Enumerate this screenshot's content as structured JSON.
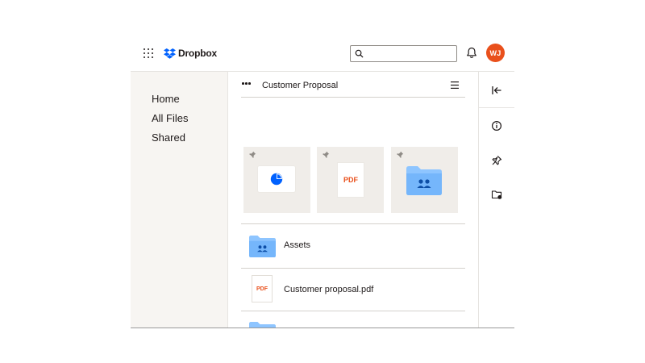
{
  "header": {
    "brand": "Dropbox",
    "search": {
      "value": "",
      "placeholder": ""
    },
    "avatar_initials": "WJ",
    "brand_color": "#0061fe",
    "avatar_color": "#e9501c"
  },
  "sidebar": {
    "items": [
      {
        "label": "Home"
      },
      {
        "label": "All Files"
      },
      {
        "label": "Shared"
      }
    ]
  },
  "main": {
    "breadcrumb_title": "Customer Proposal",
    "pinned": [
      {
        "kind": "presentation",
        "icon": "pie-chart-icon"
      },
      {
        "kind": "pdf",
        "label": "PDF"
      },
      {
        "kind": "shared-folder",
        "icon": "shared-folder-icon"
      }
    ],
    "files": [
      {
        "name": "Assets",
        "type": "shared-folder"
      },
      {
        "name": "Customer proposal.pdf",
        "type": "pdf",
        "badge": "PDF"
      },
      {
        "name": "",
        "type": "shared-folder"
      }
    ]
  },
  "right_rail": {
    "buttons": [
      "collapse-icon",
      "info-icon",
      "pin-icon",
      "folder-activity-icon"
    ]
  }
}
